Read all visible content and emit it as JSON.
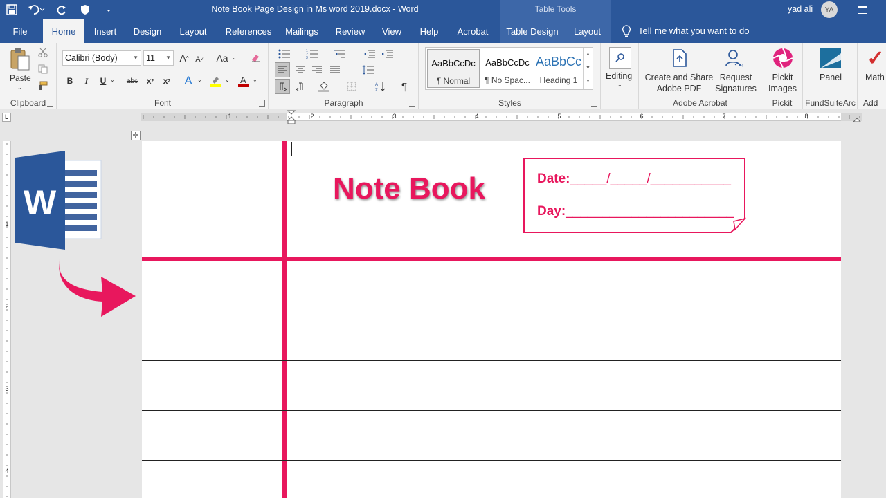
{
  "titlebar": {
    "document_title": "Note Book Page Design in Ms word 2019.docx  -  Word",
    "context_label": "Table Tools",
    "user_name": "yad ali",
    "user_initials": "YA"
  },
  "tabs": [
    "File",
    "Home",
    "Insert",
    "Design",
    "Layout",
    "References",
    "Mailings",
    "Review",
    "View",
    "Help",
    "Acrobat",
    "Table Design",
    "Layout"
  ],
  "active_tab": "Home",
  "tell_me": "Tell me what you want to do",
  "ribbon": {
    "clipboard": {
      "paste_label": "Paste",
      "group_label": "Clipboard"
    },
    "font": {
      "font_name": "Calibri (Body)",
      "font_size": "11",
      "group_label": "Font",
      "change_case": "Aa"
    },
    "paragraph": {
      "group_label": "Paragraph"
    },
    "styles": {
      "group_label": "Styles",
      "items": [
        {
          "sample": "AaBbCcDc",
          "name": "¶ Normal"
        },
        {
          "sample": "AaBbCcDc",
          "name": "¶ No Spac..."
        },
        {
          "sample": "AaBbCc",
          "name": "Heading 1"
        }
      ]
    },
    "editing": {
      "label": "Editing"
    },
    "acrobat": {
      "create_share": "Create and Share Adobe PDF",
      "request_signatures": "Request Signatures",
      "group_label": "Adobe Acrobat"
    },
    "pickit": {
      "label": "Pickit Images",
      "group_label": "Pickit"
    },
    "fundsuite": {
      "label": "Panel",
      "group_label": "FundSuiteArc"
    },
    "math": {
      "label": "Math",
      "group_label": "Add"
    }
  },
  "ruler": {
    "h_numbers": [
      "1",
      "2",
      "3",
      "4",
      "5",
      "6",
      "7",
      "8"
    ],
    "v_numbers": [
      "1",
      "2",
      "3",
      "4"
    ]
  },
  "document": {
    "title": "Note Book",
    "date_label": "Date:",
    "date_blanks": "_____/_____/___________",
    "day_label": "Day:",
    "day_blank": "_______________________"
  },
  "colors": {
    "word_blue": "#2b579a",
    "accent_pink": "#e8175d"
  }
}
